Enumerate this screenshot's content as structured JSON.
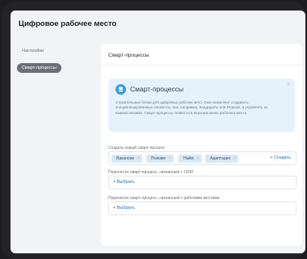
{
  "window": {
    "title": "Цифровое рабочее место"
  },
  "sidebar": {
    "items": [
      {
        "label": "Настройки"
      },
      {
        "label": "Смарт-процессы"
      }
    ]
  },
  "main": {
    "header": "Смарт-процессы",
    "info": {
      "title": "Смарт-процессы",
      "text": "Строительные блоки для цифровых рабочих мест. Они позволяют создавать специализированные элементы, как, например, Кандидаты или Резюме, и управлять их взаимосвязями. Смарт-процессы появятся в верхнем меню рабочего места",
      "close": "×"
    },
    "create_section": {
      "label": "Создать новый смарт-процесс",
      "chips": [
        {
          "label": "Вакансии"
        },
        {
          "label": "Резюме"
        },
        {
          "label": "Найм"
        },
        {
          "label": "Адаптация"
        }
      ],
      "chip_remove": "×",
      "create_label": "+ Создать"
    },
    "crm_section": {
      "label": "Перенести смарт-процесс, связанный с CRM",
      "select_label": "+ Выбрать"
    },
    "workspace_section": {
      "label": "Перенести смарт-процесс, связанный с рабочими местами",
      "select_label": "+ Выбрать"
    }
  },
  "colors": {
    "accent": "#3a9bdc",
    "chip_bg": "#d7e9f6",
    "link": "#2f6fb3"
  }
}
